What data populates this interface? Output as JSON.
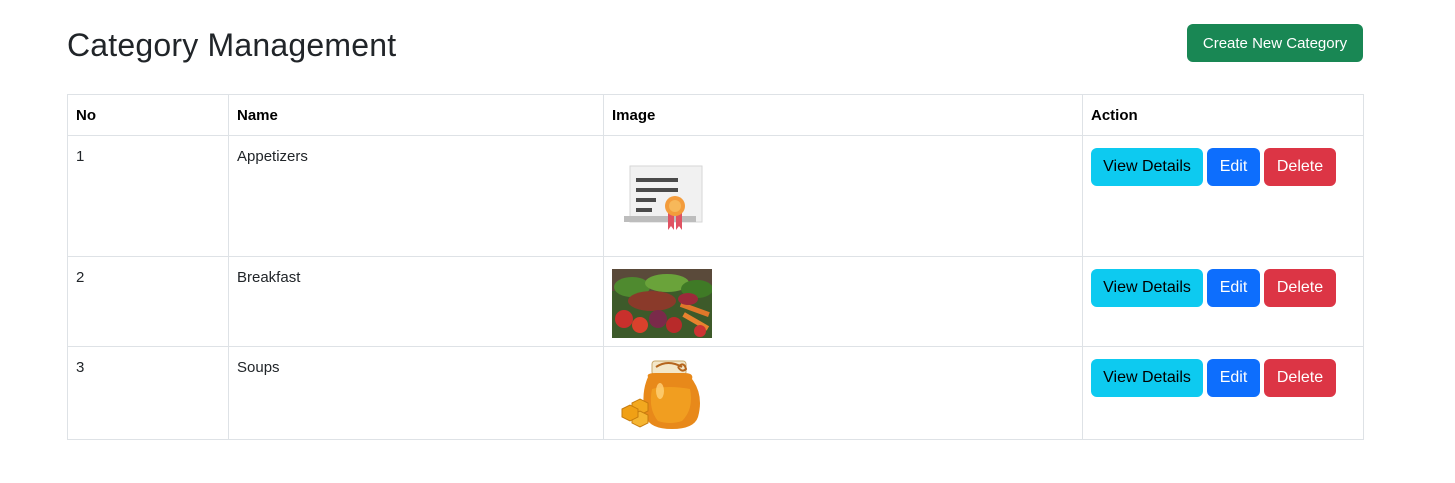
{
  "header": {
    "title": "Category Management",
    "create_button": "Create New Category"
  },
  "table": {
    "columns": [
      "No",
      "Name",
      "Image",
      "Action"
    ],
    "rows": [
      {
        "no": "1",
        "name": "Appetizers",
        "image_icon": "certificate-icon"
      },
      {
        "no": "2",
        "name": "Breakfast",
        "image_icon": "vegetables-photo"
      },
      {
        "no": "3",
        "name": "Soups",
        "image_icon": "honey-jar-icon"
      }
    ]
  },
  "actions": {
    "view": "View Details",
    "edit": "Edit",
    "delete": "Delete"
  },
  "colors": {
    "create": "#198754",
    "view": "#0dcaf0",
    "edit": "#0d6efd",
    "delete": "#dc3545"
  }
}
